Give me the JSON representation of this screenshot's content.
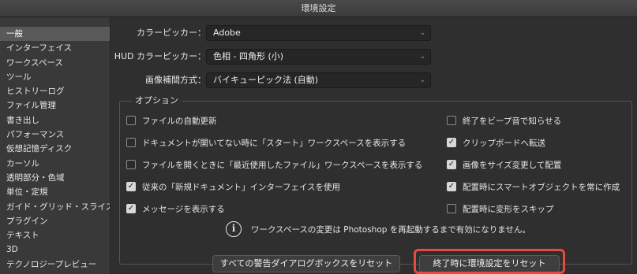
{
  "window": {
    "title": "環境設定"
  },
  "sidebar": {
    "items": [
      {
        "label": "一般",
        "selected": true
      },
      {
        "label": "インターフェイス"
      },
      {
        "label": "ワークスペース"
      },
      {
        "label": "ツール"
      },
      {
        "label": "ヒストリーログ"
      },
      {
        "label": "ファイル管理"
      },
      {
        "label": "書き出し"
      },
      {
        "label": "パフォーマンス"
      },
      {
        "label": "仮想記憶ディスク"
      },
      {
        "label": "カーソル"
      },
      {
        "label": "透明部分・色域"
      },
      {
        "label": "単位・定規"
      },
      {
        "label": "ガイド・グリッド・スライス"
      },
      {
        "label": "プラグイン"
      },
      {
        "label": "テキスト"
      },
      {
        "label": "3D"
      },
      {
        "label": "テクノロジープレビュー"
      }
    ]
  },
  "general": {
    "color_picker": {
      "label": "カラーピッカー：",
      "value": "Adobe"
    },
    "hud_color_picker": {
      "label": "HUD カラーピッカー：",
      "value": "色相 - 四角形 (小)"
    },
    "interpolation": {
      "label": "画像補間方式：",
      "value": "バイキューピック法 (自動)"
    }
  },
  "options": {
    "legend": "オプション",
    "left": [
      {
        "label": "ファイルの自動更新",
        "checked": false
      },
      {
        "label": "ドキュメントが開いてない時に「スタート」ワークスペースを表示する",
        "checked": false
      },
      {
        "label": "ファイルを開くときに「最近使用したファイル」ワークスペースを表示する",
        "checked": false
      },
      {
        "label": "従来の「新規ドキュメント」インターフェイスを使用",
        "checked": true
      },
      {
        "label": "メッセージを表示する",
        "checked": true
      }
    ],
    "right": [
      {
        "label": "終了をビープ音で知らせる",
        "checked": false
      },
      {
        "label": "クリップボードへ転送",
        "checked": true
      },
      {
        "label": "画像をサイズ変更して配置",
        "checked": true
      },
      {
        "label": "配置時にスマートオブジェクトを常に作成",
        "checked": true
      },
      {
        "label": "配置時に変形をスキップ",
        "checked": false
      }
    ],
    "info_text": "ワークスペースの変更は Photoshop を再起動するまで有効になりません。"
  },
  "buttons": {
    "reset_warnings": "すべての警告ダイアログボックスをリセット",
    "reset_prefs_on_quit": "終了時に環境設定をリセット"
  },
  "colors": {
    "highlight": "#e84a3d",
    "selected_item": "#595959"
  }
}
